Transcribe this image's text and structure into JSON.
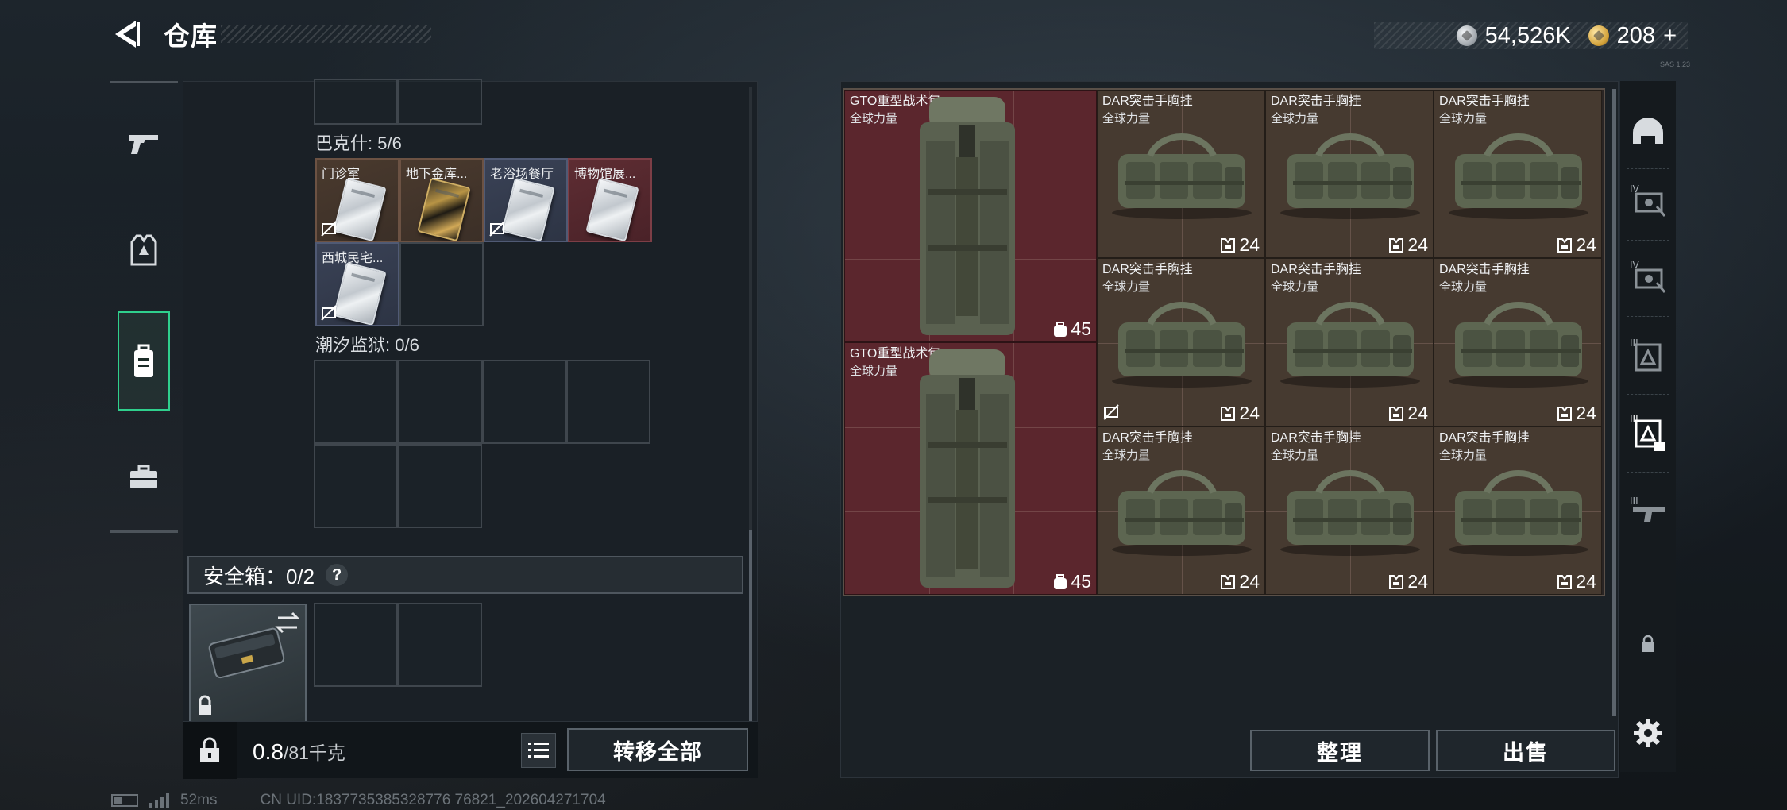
{
  "header": {
    "title": "仓库",
    "currency": {
      "silver_value": "54,526K",
      "gold_value": "208",
      "gold_add": "+"
    },
    "version_text": "SAS 1.23"
  },
  "left_rail": {
    "items": [
      {
        "name": "weapons",
        "icon": "pistol-icon"
      },
      {
        "name": "equipment",
        "icon": "vest-icon"
      },
      {
        "name": "backpack",
        "icon": "backpack-icon",
        "active": true
      },
      {
        "name": "toolbox",
        "icon": "briefcase-icon"
      }
    ]
  },
  "stash": {
    "sections": [
      {
        "title": "巴克什: 5/6",
        "cards": [
          {
            "label": "门诊室",
            "color": "brown",
            "notrade": true,
            "gold": false
          },
          {
            "label": "地下金库...",
            "color": "brown",
            "notrade": false,
            "gold": true
          },
          {
            "label": "老浴场餐厅",
            "color": "blue",
            "notrade": true,
            "gold": false
          },
          {
            "label": "博物馆展...",
            "color": "red",
            "notrade": false,
            "gold": false
          },
          {
            "label": "西城民宅...",
            "color": "blue",
            "notrade": true,
            "gold": false
          }
        ]
      },
      {
        "title": "潮汐监狱: 0/6",
        "cards": []
      }
    ],
    "safebox": {
      "label": "安全箱：0/2",
      "help": "?"
    },
    "footer": {
      "weight_value": "0.8",
      "weight_unit": "/81千克",
      "transfer_all": "转移全部"
    }
  },
  "container": {
    "items": [
      {
        "name": "GTO重型战术包",
        "sub": "全球力量",
        "count": "45",
        "count_icon": "backpack-capacity-icon",
        "color": "red",
        "type": "backpack"
      },
      {
        "name": "GTO重型战术包",
        "sub": "全球力量",
        "count": "45",
        "count_icon": "backpack-capacity-icon",
        "color": "red",
        "type": "backpack"
      },
      {
        "name": "DAR突击手胸挂",
        "sub": "全球力量",
        "count": "24",
        "count_icon": "chest-rig-icon",
        "color": "brown",
        "type": "rig",
        "notrade": false
      },
      {
        "name": "DAR突击手胸挂",
        "sub": "全球力量",
        "count": "24",
        "count_icon": "chest-rig-icon",
        "color": "brown",
        "type": "rig",
        "notrade": false
      },
      {
        "name": "DAR突击手胸挂",
        "sub": "全球力量",
        "count": "24",
        "count_icon": "chest-rig-icon",
        "color": "brown",
        "type": "rig",
        "notrade": false
      },
      {
        "name": "DAR突击手胸挂",
        "sub": "全球力量",
        "count": "24",
        "count_icon": "chest-rig-icon",
        "color": "brown",
        "type": "rig",
        "notrade": true
      },
      {
        "name": "DAR突击手胸挂",
        "sub": "全球力量",
        "count": "24",
        "count_icon": "chest-rig-icon",
        "color": "brown",
        "type": "rig",
        "notrade": false
      },
      {
        "name": "DAR突击手胸挂",
        "sub": "全球力量",
        "count": "24",
        "count_icon": "chest-rig-icon",
        "color": "brown",
        "type": "rig",
        "notrade": false
      },
      {
        "name": "DAR突击手胸挂",
        "sub": "全球力量",
        "count": "24",
        "count_icon": "chest-rig-icon",
        "color": "brown",
        "type": "rig",
        "notrade": false
      },
      {
        "name": "DAR突击手胸挂",
        "sub": "全球力量",
        "count": "24",
        "count_icon": "chest-rig-icon",
        "color": "brown",
        "type": "rig",
        "notrade": false
      },
      {
        "name": "DAR突击手胸挂",
        "sub": "全球力量",
        "count": "24",
        "count_icon": "chest-rig-icon",
        "color": "brown",
        "type": "rig",
        "notrade": false
      }
    ],
    "buttons": {
      "tidy": "整理",
      "sell": "出售"
    }
  },
  "right_rail": {
    "items": [
      {
        "name": "helmet-tab",
        "icon": "helmet-icon"
      },
      {
        "name": "armor-iv-tab",
        "icon": "armor-iv-icon"
      },
      {
        "name": "armor-iv-tab-2",
        "icon": "armor-iv-icon"
      },
      {
        "name": "rig-iii-tab",
        "icon": "rig-iii-icon"
      },
      {
        "name": "rig-iii-tab-active",
        "icon": "rig-iii-icon"
      },
      {
        "name": "gun-iii-tab",
        "icon": "gun-iii-icon"
      },
      {
        "name": "locked-tab",
        "icon": "lock-icon"
      },
      {
        "name": "settings-tab",
        "icon": "gear-icon"
      }
    ]
  },
  "status": {
    "ping": "52ms",
    "uid": "CN UID:1837735385328776 76821_202604271704"
  },
  "colors": {
    "accent_green": "#2fd08d",
    "red_item": "#5b262d",
    "brown_item": "#463a30",
    "blue_card": "#3a4256"
  }
}
